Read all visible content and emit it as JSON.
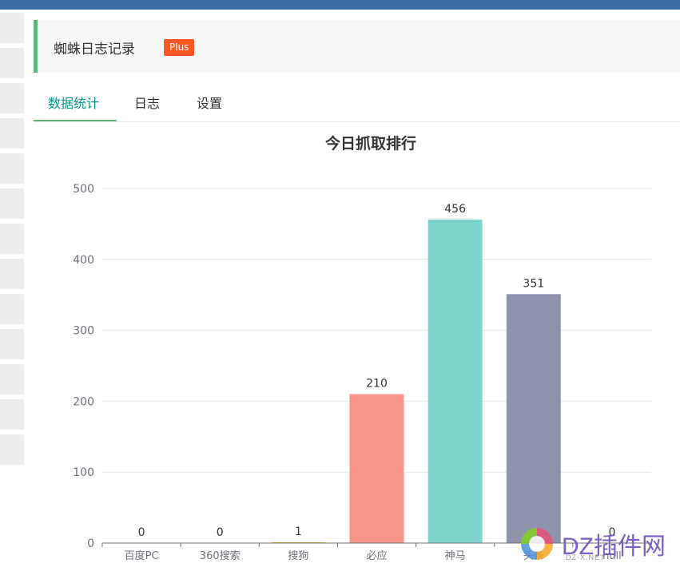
{
  "header": {
    "title": "蜘蛛日志记录",
    "badge": "Plus"
  },
  "tabs": [
    {
      "label": "数据统计",
      "active": true
    },
    {
      "label": "日志",
      "active": false
    },
    {
      "label": "设置",
      "active": false
    }
  ],
  "chart_data": {
    "type": "bar",
    "title": "今日抓取排行",
    "categories": [
      "百度PC",
      "360搜索",
      "搜狗",
      "必应",
      "神马",
      "头条",
      "null"
    ],
    "values": [
      0,
      0,
      1,
      210,
      456,
      351,
      0
    ],
    "colors": [
      "#c23531",
      "#2f4554",
      "#e6b600",
      "#f7958a",
      "#7ed3ce",
      "#9093ac",
      "#8bc34a"
    ],
    "yticks": [
      0,
      100,
      200,
      300,
      400,
      500
    ],
    "ylim": [
      0,
      500
    ],
    "grid": true
  },
  "watermark": {
    "text": "DZ插件网",
    "sub": "DZ-X.NET"
  },
  "colors": {
    "accent": "#009688",
    "topbar": "#3a6ea5",
    "badge": "#ff5722",
    "header_border": "#5fb878"
  }
}
